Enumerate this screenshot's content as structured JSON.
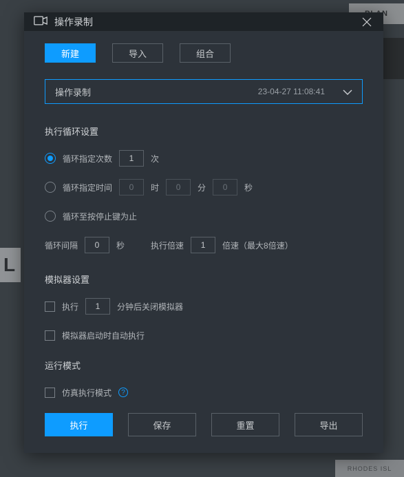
{
  "titlebar": {
    "title": "操作录制"
  },
  "tabs": {
    "new": "新建",
    "import": "导入",
    "combine": "组合"
  },
  "dropdown": {
    "label": "操作录制",
    "timestamp": "23-04-27 11:08:41"
  },
  "sections": {
    "loop_title": "执行循环设置",
    "emulator_title": "模拟器设置",
    "mode_title": "运行模式"
  },
  "loop": {
    "opt_count_label": "循环指定次数",
    "opt_count_value": "1",
    "opt_count_unit": "次",
    "opt_time_label": "循环指定时间",
    "hours": "0",
    "hours_unit": "时",
    "mins": "0",
    "mins_unit": "分",
    "secs": "0",
    "secs_unit": "秒",
    "opt_stopkey_label": "循环至按停止键为止",
    "interval_label": "循环间隔",
    "interval_value": "0",
    "interval_unit": "秒",
    "speed_label": "执行倍速",
    "speed_value": "1",
    "speed_hint": "倍速（最大8倍速）"
  },
  "emulator": {
    "close_label_pre": "执行",
    "close_value": "1",
    "close_label_post": "分钟后关闭模拟器",
    "autorun_label": "模拟器启动时自动执行"
  },
  "mode": {
    "sim_label": "仿真执行模式"
  },
  "footer": {
    "run": "执行",
    "save": "保存",
    "reset": "重置",
    "export": "导出"
  },
  "bg": {
    "plan": "PLAN",
    "l": "L",
    "rhodes": "RHODES ISL"
  }
}
